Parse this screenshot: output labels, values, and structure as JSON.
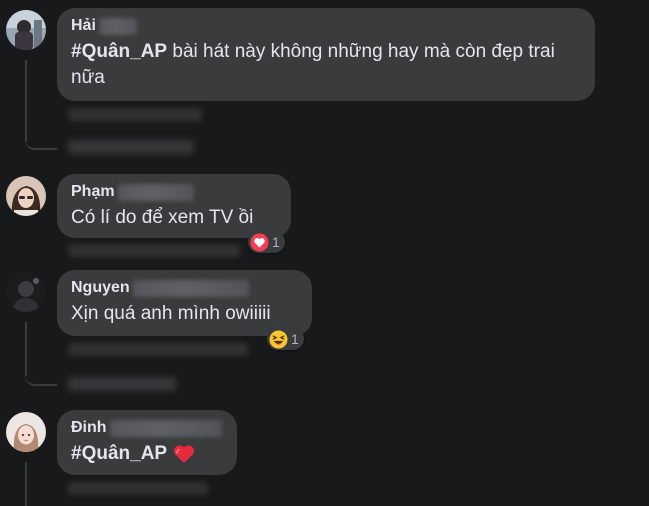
{
  "comments": [
    {
      "author": "Hải",
      "hashtag": "#Quân_AP",
      "text": " bài hát này không những hay mà còn đẹp trai nữa",
      "avatar_icon": "user-avatar"
    },
    {
      "author": "Phạm",
      "text": "Có lí do để xem TV ồi",
      "reaction": {
        "icon": "heart-reaction-icon",
        "count": "1"
      },
      "avatar_icon": "user-avatar"
    },
    {
      "author": "Nguyen",
      "text": "Xịn quá anh mình owiiiii",
      "reaction": {
        "icon": "laughing-face-icon",
        "count": "1"
      },
      "avatar_icon": "user-avatar"
    },
    {
      "author": "Đinh",
      "hashtag": "#Quân_AP",
      "text": "",
      "emoji": "red-heart-icon",
      "avatar_icon": "user-avatar"
    }
  ],
  "colors": {
    "background": "#18191a",
    "bubble": "#3a3b3c",
    "text": "#e4e6eb",
    "muted": "#b0b3b8",
    "heart": "#f33e58"
  }
}
